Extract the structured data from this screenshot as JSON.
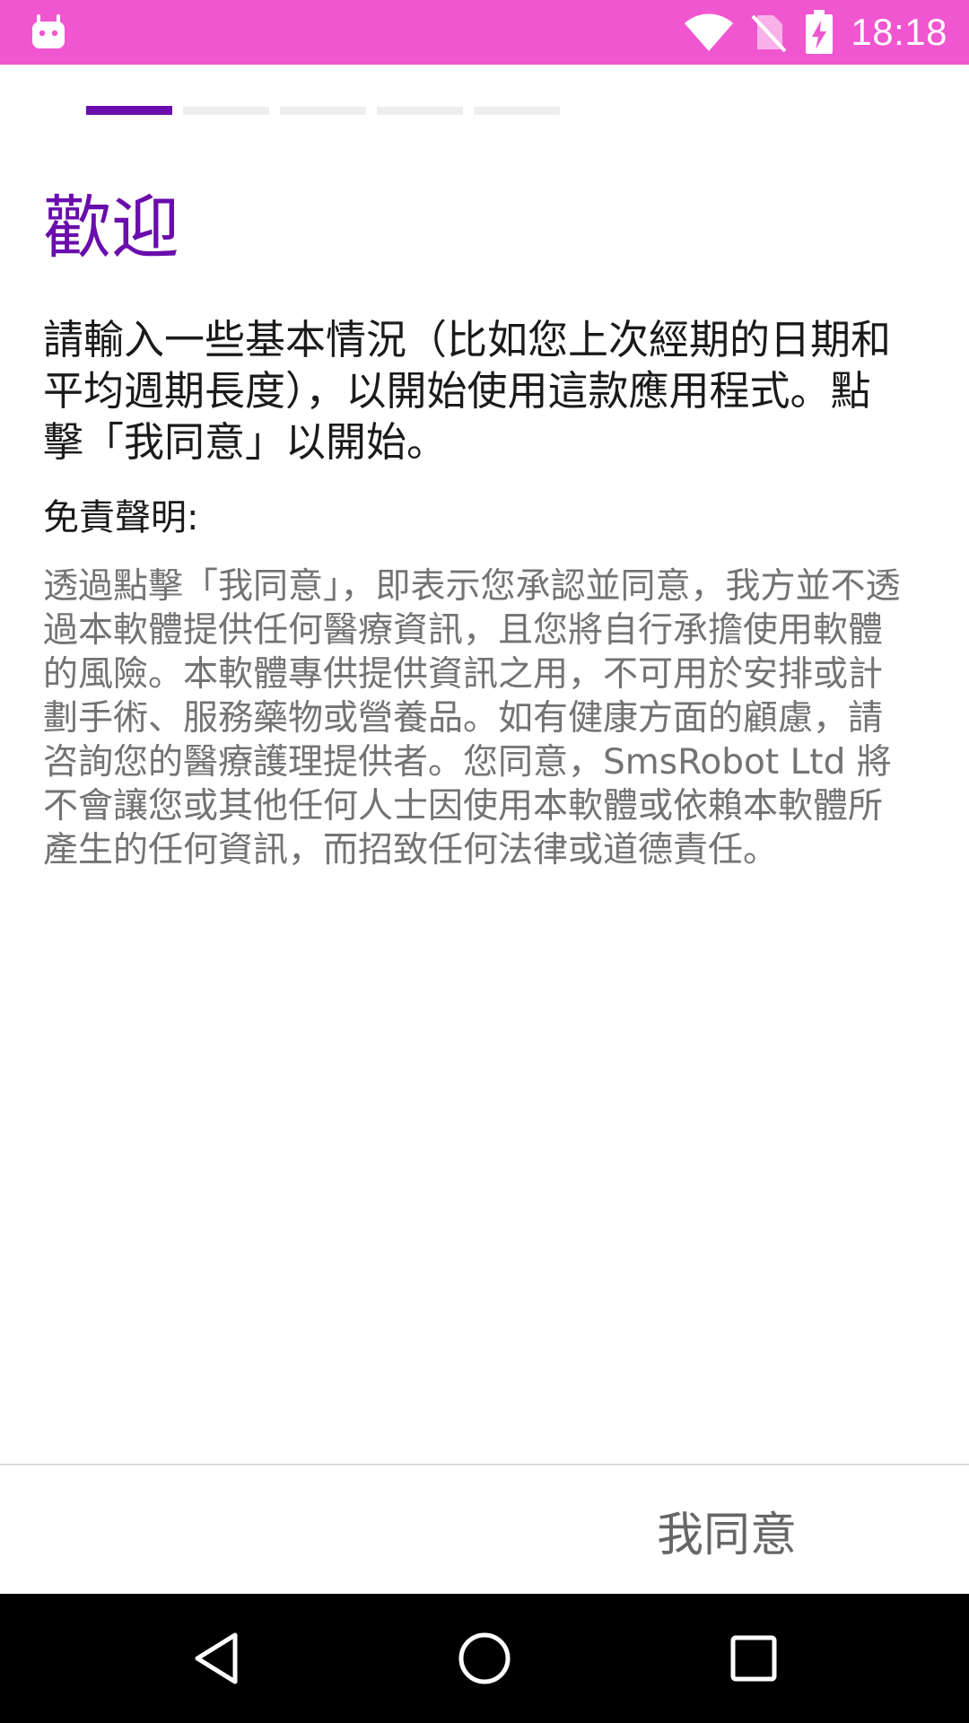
{
  "status_bar": {
    "time": "18:18",
    "left_icon": "android-robot-icon",
    "icons": [
      "wifi-icon",
      "no-sim-icon",
      "battery-charging-icon"
    ],
    "color": "#f056cf"
  },
  "steps": {
    "total": 5,
    "current": 1,
    "active_color": "#6a0dad",
    "inactive_color": "#eeeeee"
  },
  "content": {
    "title": "歡迎",
    "intro": "請輸入一些基本情況（比如您上次經期的日期和平均週期長度），以開始使用這款應用程式。點擊「我同意」以開始。",
    "disclaimer_heading": "免責聲明:",
    "disclaimer_text": "透過點擊「我同意」，即表示您承認並同意，我方並不透過本軟體提供任何醫療資訊，且您將自行承擔使用軟體的風險。本軟體專供提供資訊之用，不可用於安排或計劃手術、服務藥物或營養品。如有健康方面的顧慮，請咨詢您的醫療護理提供者。您同意，SmsRobot Ltd 將不會讓您或其他任何人士因使用本軟體或依賴本軟體所產生的任何資訊，而招致任何法律或道德責任。"
  },
  "actions": {
    "agree_label": "我同意"
  },
  "nav_bar": {
    "icons": [
      "back-icon",
      "home-icon",
      "recents-icon"
    ]
  }
}
